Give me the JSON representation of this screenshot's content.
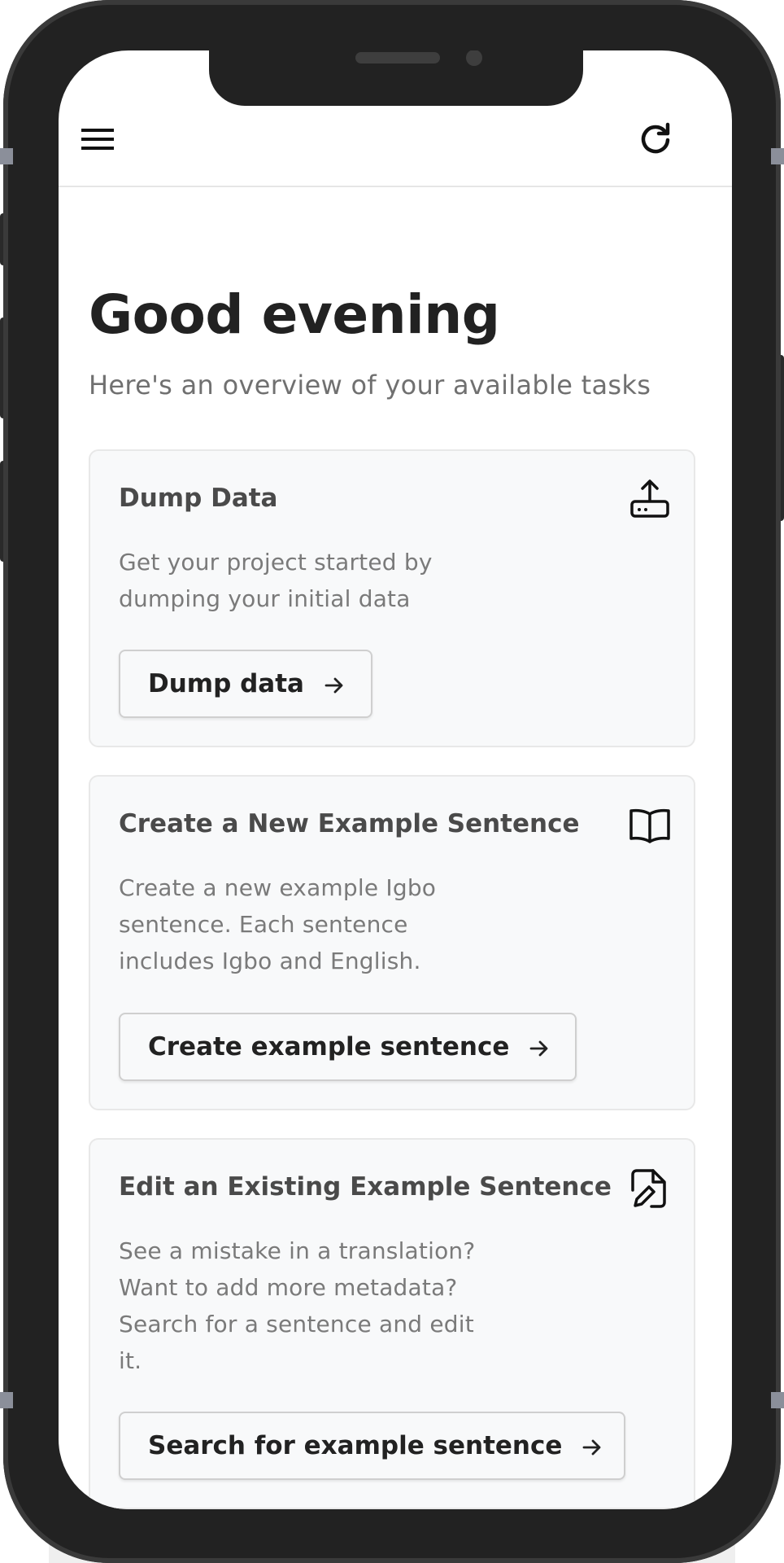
{
  "header": {
    "menu_icon": "hamburger-menu-icon",
    "refresh_icon": "refresh-icon"
  },
  "main": {
    "greeting": "Good evening",
    "subtitle": "Here's an overview of your available tasks"
  },
  "cards": [
    {
      "title": "Dump Data",
      "icon": "upload-drive-icon",
      "description": "Get your project started by dumping your initial data",
      "button_label": "Dump data"
    },
    {
      "title": "Create a New Example Sentence",
      "icon": "open-book-icon",
      "description": "Create a new example Igbo sentence. Each sentence includes Igbo and English.",
      "button_label": "Create example sentence"
    },
    {
      "title": "Edit an Existing Example Sentence",
      "icon": "file-edit-icon",
      "description": "See a mistake in a translation? Want to add more metadata? Search for a sentence and edit it.",
      "button_label": "Search for example sentence"
    }
  ],
  "colors": {
    "card_background": "#f8f9fa",
    "card_border": "#e8e8e8",
    "heading_text": "#222222",
    "muted_text": "#707070",
    "device_frame": "#222222"
  }
}
